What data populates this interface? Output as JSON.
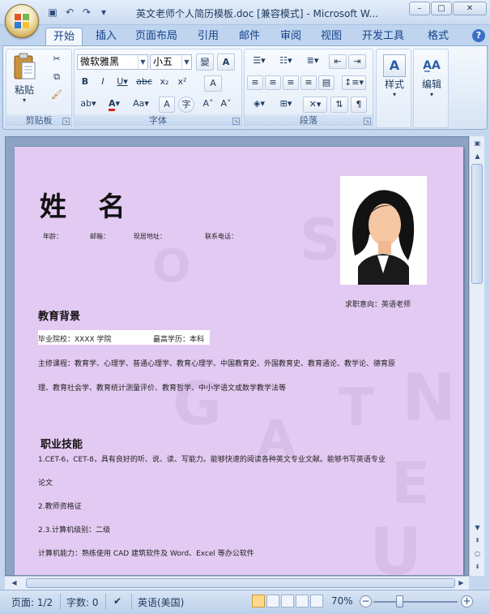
{
  "window": {
    "title": "英文老师个人简历模板.doc [兼容模式] - Microsoft W...",
    "quick_access": [
      "save-icon",
      "undo-icon",
      "redo-icon",
      "customize-icon"
    ],
    "controls": [
      "–",
      "□",
      "✕"
    ]
  },
  "tabs": [
    "开始",
    "插入",
    "页面布局",
    "引用",
    "邮件",
    "审阅",
    "视图",
    "开发工具",
    "格式"
  ],
  "active_tab": "开始",
  "ribbon": {
    "clipboard": {
      "label": "剪贴板",
      "paste": "粘贴"
    },
    "font": {
      "label": "字体",
      "font_name": "微软雅黑",
      "font_size": "小五"
    },
    "paragraph": {
      "label": "段落"
    },
    "styles": {
      "label": "样式"
    },
    "editing": {
      "label": "编辑"
    }
  },
  "document": {
    "name": "姓 名",
    "info": [
      "年龄：",
      "邮箱：",
      "现居地址：",
      "联系电话："
    ],
    "intent": "求职意向：英语老师",
    "education_title": "教育背景",
    "school_line": "毕业院校：XXXX 学院",
    "degree_line": "最高学历：本科",
    "courses_line1": "主修课程：教育学、心理学、普通心理学、教育心理学、中国教育史、外国教育史、教育通论、教学论、德育原",
    "courses_line2": "理、教育社会学、教育统计测量评价、教育哲学、中小学语文或数学教学法等",
    "skills_title": "职业技能",
    "skill1_line1": "1.CET-6，CET-8，具有良好的听、说、读、写能力。能够快速的阅读各种英文专业文献。能够书写英语专业",
    "skill1_line2": "论文",
    "skill2": "2.教师资格证",
    "skill3": "2.3.计算机级别：二级",
    "skill4": "计算机能力：熟练使用 CAD 建筑软件及 Word、Excel 等办公软件"
  },
  "status": {
    "page": "页面: 1/2",
    "words": "字数: 0",
    "language": "英语(美国)",
    "zoom": "70%",
    "zoom_level": 0.7
  },
  "colors": {
    "page_bg": "#e3caf2",
    "ribbon_bg": "#dfe9f5"
  }
}
